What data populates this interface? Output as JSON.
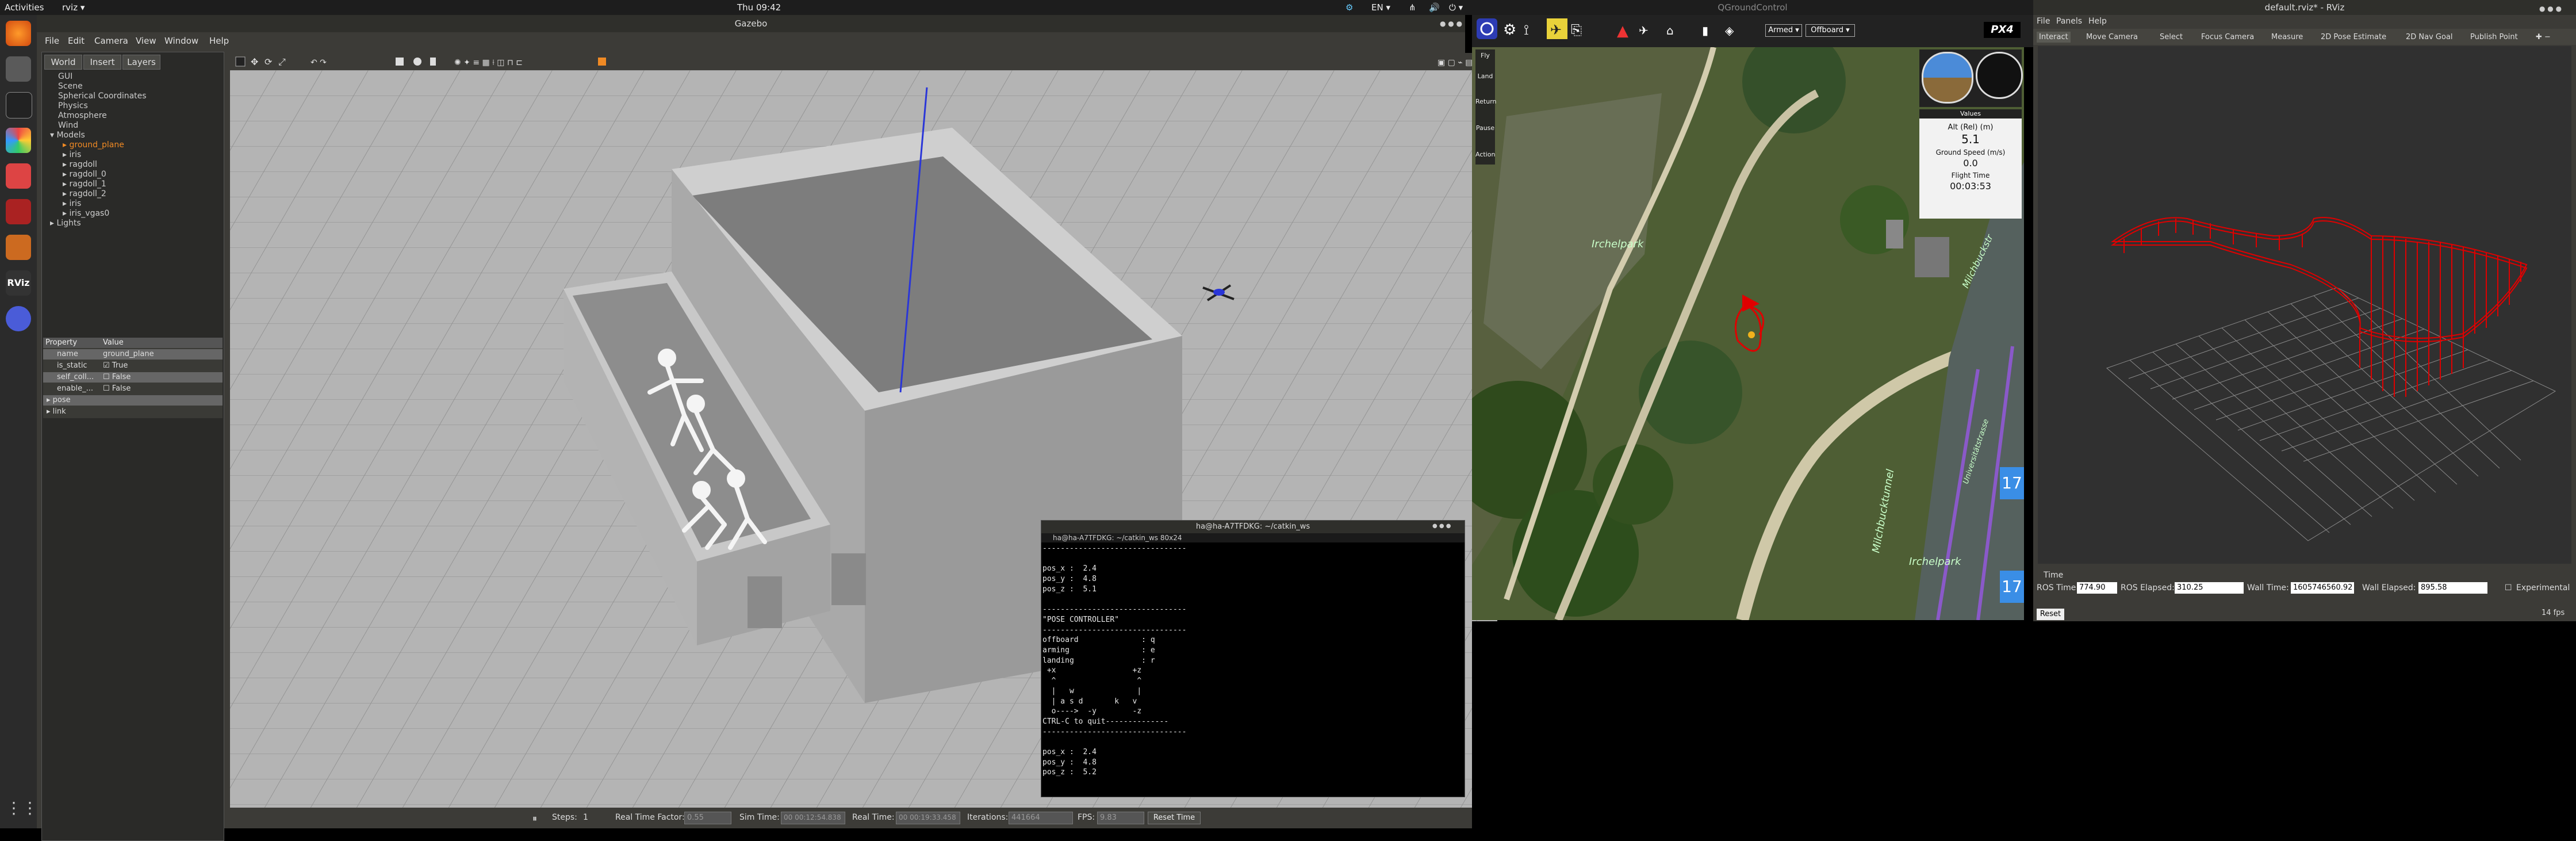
{
  "topbar": {
    "activities": "Activities",
    "app": "rviz ▾",
    "clock": "Thu 09:42",
    "lang": "EN ▾"
  },
  "gazebo": {
    "title": "Gazebo",
    "menu": [
      "File",
      "Edit",
      "Camera",
      "View",
      "Window",
      "Help"
    ],
    "tabs": [
      "World",
      "Insert",
      "Layers"
    ],
    "tree": [
      "GUI",
      "Scene",
      "Spherical Coordinates",
      "Physics",
      "Atmosphere",
      "Wind",
      "▾ Models",
      "▸ ground_plane",
      "▸ iris",
      "▸ ragdoll",
      "▸ ragdoll_0",
      "▸ ragdoll_1",
      "▸ ragdoll_2",
      "▸ iris",
      "▸ iris_vgas0",
      "▸ Lights"
    ],
    "props_header": [
      "Property",
      "Value"
    ],
    "props": [
      [
        "name",
        "ground_plane"
      ],
      [
        "is_static",
        "☑ True"
      ],
      [
        "self_coll...",
        "☐ False"
      ],
      [
        "enable_...",
        "☐ False"
      ],
      [
        "▸ pose",
        ""
      ],
      [
        "▸ link",
        ""
      ]
    ],
    "bottom": {
      "steps_label": "Steps:",
      "steps_val": "1",
      "rtf_label": "Real Time Factor:",
      "rtf": "0.55",
      "sim_label": "Sim Time:",
      "sim": "00 00:12:54.838",
      "real_label": "Real Time:",
      "real": "00 00:19:33.458",
      "iter_label": "Iterations:",
      "iter": "441664",
      "fps_label": "FPS:",
      "fps": "9.83",
      "reset": "Reset Time"
    }
  },
  "terminal": {
    "title": "ha@ha-A7TFDKG: ~/catkin_ws",
    "tab": "ha@ha-A7TFDKG: ~/catkin_ws 80x24",
    "text": "--------------------------------\n\npos_x :  2.4\npos_y :  4.8\npos_z :  5.1\n\n--------------------------------\n\"POSE CONTROLLER\"\n--------------------------------\noffboard              : q\narming                : e\nlanding               : r\n +x                 +z\n  ^                  ^\n  |   w              |\n  | a s d       k   v\n  o---->  -y        -z\nCTRL-C to quit--------------\n--------------------------------\n\npos_x :  2.4\npos_y :  4.8\npos_z :  5.2"
  },
  "qgc": {
    "title": "QGroundControl",
    "armed": "Armed ▾",
    "mode": "Offboard ▾",
    "px4": "PX4",
    "left_tools": [
      "Fly",
      "Land",
      "Return",
      "Pause",
      "Action"
    ],
    "values_tab": "Values",
    "alt_label": "Alt (Rel) (m)",
    "alt": "5.1",
    "gs_label": "Ground Speed (m/s)",
    "gs": "0.0",
    "ft_label": "Flight Time",
    "ft": "00:03:53",
    "map_labels": [
      "Irchelpark",
      "Milchbuckstr",
      "Milchbucktunnel",
      "Irchelpark",
      "Universitätstrasse"
    ],
    "scale": "17"
  },
  "rviz": {
    "title": "default.rviz* - RViz",
    "menu": [
      "File",
      "Panels",
      "Help"
    ],
    "tools": [
      "Interact",
      "Move Camera",
      "Select",
      "Focus Camera",
      "Measure",
      "2D Pose Estimate",
      "2D Nav Goal",
      "Publish Point"
    ],
    "time_title": "Time",
    "ros_time_label": "ROS Time:",
    "ros_time": "774.90",
    "ros_elapsed_label": "ROS Elapsed:",
    "ros_elapsed": "310.25",
    "wall_time_label": "Wall Time:",
    "wall_time": "1605746560.92",
    "wall_elapsed_label": "Wall Elapsed:",
    "wall_elapsed": "895.58",
    "experimental": "Experimental",
    "reset": "Reset",
    "fps": "14 fps"
  },
  "colors": {
    "trajectory": "#e00000",
    "sky_axis": "#2a36d8",
    "gazebo_bg": "#b4b4b4"
  }
}
